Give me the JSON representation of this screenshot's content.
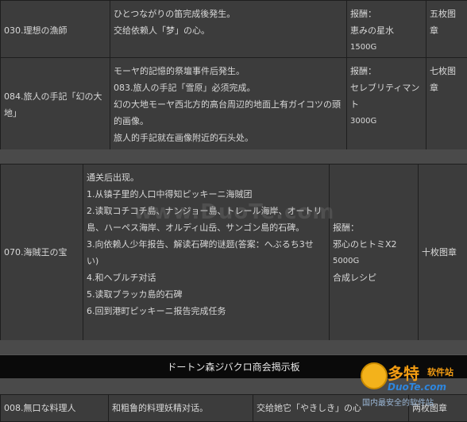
{
  "quests": [
    {
      "name": "030.理想の漁師",
      "desc": [
        "ひとつながりの笛完成後発生。",
        "交给依赖人「梦」の心。"
      ],
      "reward_label": "报酬：",
      "reward_lines": [
        "恵みの星水",
        "1500G"
      ],
      "stamp": "五枚图章"
    },
    {
      "name": "084.旅人の手記「幻の大地」",
      "desc": [
        "モーヤ的記憶的祭壇事件后発生。",
        "083.旅人の手記「雪原」必须完成。",
        "幻の大地モーヤ西北方的高台周辺的地面上有ガイコツの頭的画像。",
        "旅人的手記就在画像附近的石头处。"
      ],
      "reward_label": "报酬：",
      "reward_lines": [
        "セレブリティマント",
        "3000G"
      ],
      "stamp": "七枚图章"
    },
    {
      "name": "070.海賊王の宝",
      "desc": [
        "通关后出现。",
        "1.从镇子里的人口中得知ピッキーニ海賊团",
        "2.读取コチコチ島、ナンジョー島、トレール海岸、オートリ島、ハーペス海岸、オルディ山岳、サンゴン島的石碑。",
        "3.向依赖人少年报告、解读石碑的谜题(答案：へぶるち3せい)",
        "4.和ヘブルチ对话",
        "5.读取ブラッカ島的石碑",
        "6.回到港町ピッキーニ报告完成任务"
      ],
      "reward_label": "报酬：",
      "reward_lines": [
        "邪心のヒトミX2",
        "5000G",
        "合成レシピ"
      ],
      "stamp": "十枚图章"
    }
  ],
  "banner": "ドートン森ジバクロ商会揭示板",
  "bottom_row": {
    "name": "008.無口な料理人",
    "desc": "和粗鲁的料理妖精对话。",
    "task": "交给她它「やきしき」の心",
    "stamp": "两枚图章"
  },
  "watermarks": {
    "center": "www.DuoTe.com",
    "logo_title": "多特",
    "logo_sub": "软件站",
    "logo_url": "DuoTe.com",
    "logo_slogan": "国内最安全的软件站"
  }
}
